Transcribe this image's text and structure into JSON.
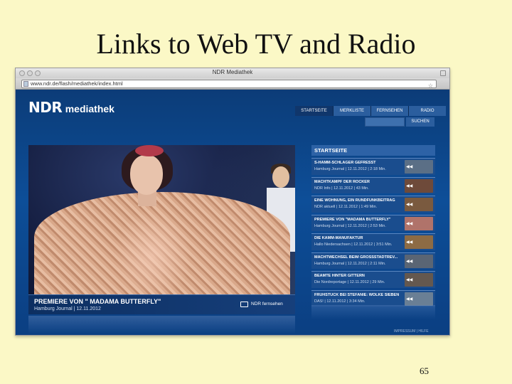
{
  "slide": {
    "title": "Links to Web TV and Radio",
    "page_number": "65"
  },
  "browser": {
    "window_title": "NDR Mediathek",
    "url": "www.ndr.de/flash/mediathek/index.html"
  },
  "site": {
    "logo_ndr": "NDR",
    "logo_mediathek": "mediathek",
    "nav": [
      "STARTSEITE",
      "MERKLISTE",
      "FERNSEHEN",
      "RADIO"
    ],
    "search_label": "SUCHEN"
  },
  "hero": {
    "title": "PREMIERE VON \" MADAMA BUTTERFLY\"",
    "subtitle": "Hamburg Journal | 12.11.2012",
    "channel_label": "NDR fernsehen"
  },
  "list": {
    "header": "STARTSEITE",
    "items": [
      {
        "title": "S-HAMM-SCHLÄGER GEFRESST",
        "meta": "Hamburg Journal | 12.11.2012 | 2:18 Min.",
        "thumb_color": "#5b6f86"
      },
      {
        "title": "MACHTKAMPF DER ROCKER",
        "meta": "NDR Info | 12.11.2012 | 43 Min.",
        "thumb_color": "#6e4a3a"
      },
      {
        "title": "EINE WOHNUNG, EIN RUNDFUNKBEITRAG",
        "meta": "NDR aktuell | 12.11.2012 | 1:49 Min.",
        "thumb_color": "#7a5a3f"
      },
      {
        "title": "PREMIERE VON \"MADAMA BUTTERFLY\"",
        "meta": "Hamburg Journal | 12.11.2012 | 2:53 Min.",
        "thumb_color": "#b0736a"
      },
      {
        "title": "DIE KAMM-MANUFAKTUR",
        "meta": "Hallo Niedersachsen | 12.11.2012 | 3:51 Min.",
        "thumb_color": "#8d6b44"
      },
      {
        "title": "MACHTWECHSEL BEIM GROSSSTADTREV...",
        "meta": "Hamburg Journal | 12.11.2012 | 2:11 Min.",
        "thumb_color": "#5a6574"
      },
      {
        "title": "BEAMTE HINTER GITTERN",
        "meta": "Die Nordreportage | 12.11.2012 | 29 Min.",
        "thumb_color": "#64584f"
      },
      {
        "title": "FRÜHSTÜCK BEI STEFANIE: WOLKE SIEBEN",
        "meta": "DAS! | 12.11.2012 | 3:34 Min.",
        "thumb_color": "#6a7f95"
      }
    ]
  },
  "footer": {
    "links": "IMPRESSUM | HILFE"
  }
}
